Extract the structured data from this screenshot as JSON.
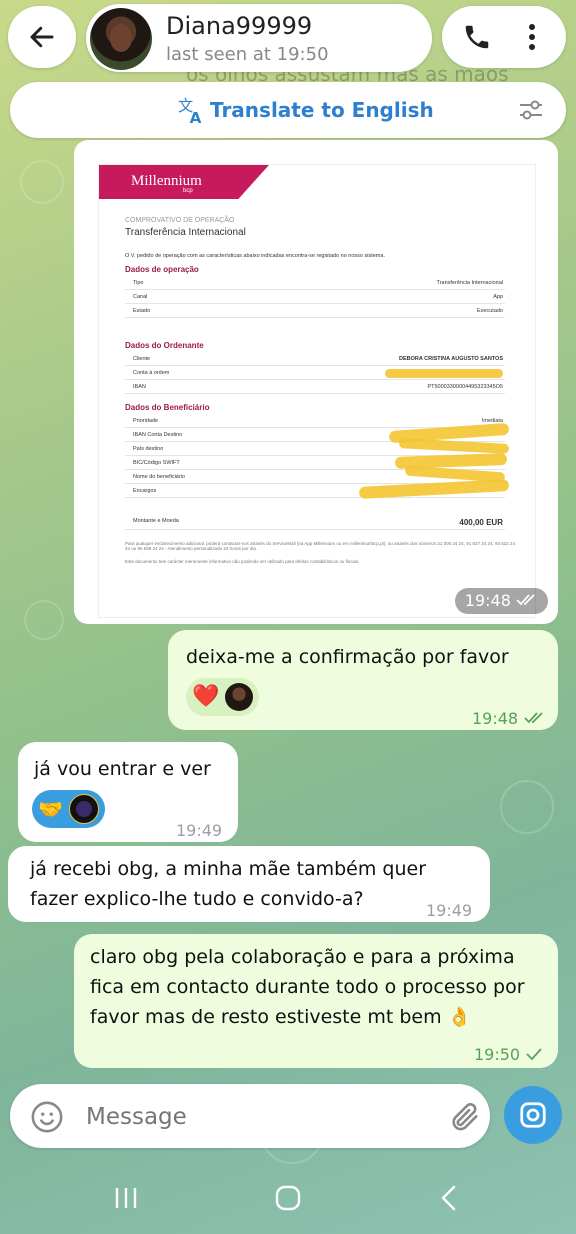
{
  "header": {
    "contact_name": "Diana99999",
    "status": "last seen at 19:50",
    "behind_text": "os olhos assustam mas as mãos"
  },
  "translate_bar": {
    "label": "Translate to English"
  },
  "image_message": {
    "time": "19:48",
    "document": {
      "logo": "Millennium",
      "logo_sub": "bcp",
      "kicker": "COMPROVATIVO DE OPERAÇÃO",
      "title": "Transferência Internacional",
      "intro": "O V. pedido de operação com as características abaixo indicadas encontra-se registado no nosso sistema.",
      "section_operation": "Dados de operação",
      "operation_rows": [
        {
          "label": "Tipo",
          "value": "Transferência Internacional"
        },
        {
          "label": "Canal",
          "value": "App"
        },
        {
          "label": "Estado",
          "value": "Executado"
        }
      ],
      "section_sender": "Dados do Ordenante",
      "sender_rows": [
        {
          "label": "Cliente",
          "value": "DEBORA CRISTINA AUGUSTO SANTOS"
        },
        {
          "label": "Conta à ordem",
          "value": ""
        },
        {
          "label": "IBAN",
          "value": "PT50003300004495323345O5"
        }
      ],
      "section_beneficiary": "Dados do Beneficiário",
      "beneficiary_rows": [
        {
          "label": "Prioridade",
          "value": "Imediata"
        },
        {
          "label": "IBAN Conta Destino",
          "value": ""
        },
        {
          "label": "País destino",
          "value": ""
        },
        {
          "label": "BIC/Código SWIFT",
          "value": ""
        },
        {
          "label": "Nome do beneficiário",
          "value": ""
        },
        {
          "label": "Encargos",
          "value": ""
        }
      ],
      "amount_label": "Montante e Moeda",
      "amount_value": "400,00 EUR",
      "footer_1": "Para qualquer esclarecimento adicional, poderá contactar-nos através do ServiceMail (na App Millennium ou em millenniumbcp.pt), ou através dos números 21 000 24 24, 91 827 24 24, 93 522 24 24 ou 96 599 24 24 - Atendimento personalizado 24 horas por dia.",
      "footer_2": "Este documento tem carácter meramente informativo não podendo ser utilizado para efeitos contabilísticos ou fiscais."
    }
  },
  "messages": [
    {
      "direction": "out",
      "text": "deixa-me a confirmação por favor",
      "time": "19:48",
      "reaction": "❤️"
    },
    {
      "direction": "in",
      "text": "já vou entrar e ver",
      "time": "19:49",
      "reaction": "🤝"
    },
    {
      "direction": "in",
      "text": "já recebi obg, a minha mãe também quer fazer explico-lhe tudo e convido-a?",
      "time": "19:49"
    },
    {
      "direction": "out",
      "text": "claro obg pela colaboração e para a próxima fica em contacto durante todo o processo por favor mas de resto estiveste mt bem 👌",
      "time": "19:50"
    }
  ],
  "input": {
    "placeholder": "Message"
  },
  "colors": {
    "accent": "#3a9de0",
    "outgoing": "#effdde",
    "check": "#5aa05a",
    "translate": "#2f7fcf"
  },
  "icons": [
    "back-arrow-icon",
    "phone-icon",
    "more-vert-icon",
    "translate-icon",
    "settings-sliders-icon",
    "double-check-icon",
    "emoji-icon",
    "attach-icon",
    "camera-icon",
    "nav-recents-icon",
    "nav-home-icon",
    "nav-back-icon"
  ]
}
